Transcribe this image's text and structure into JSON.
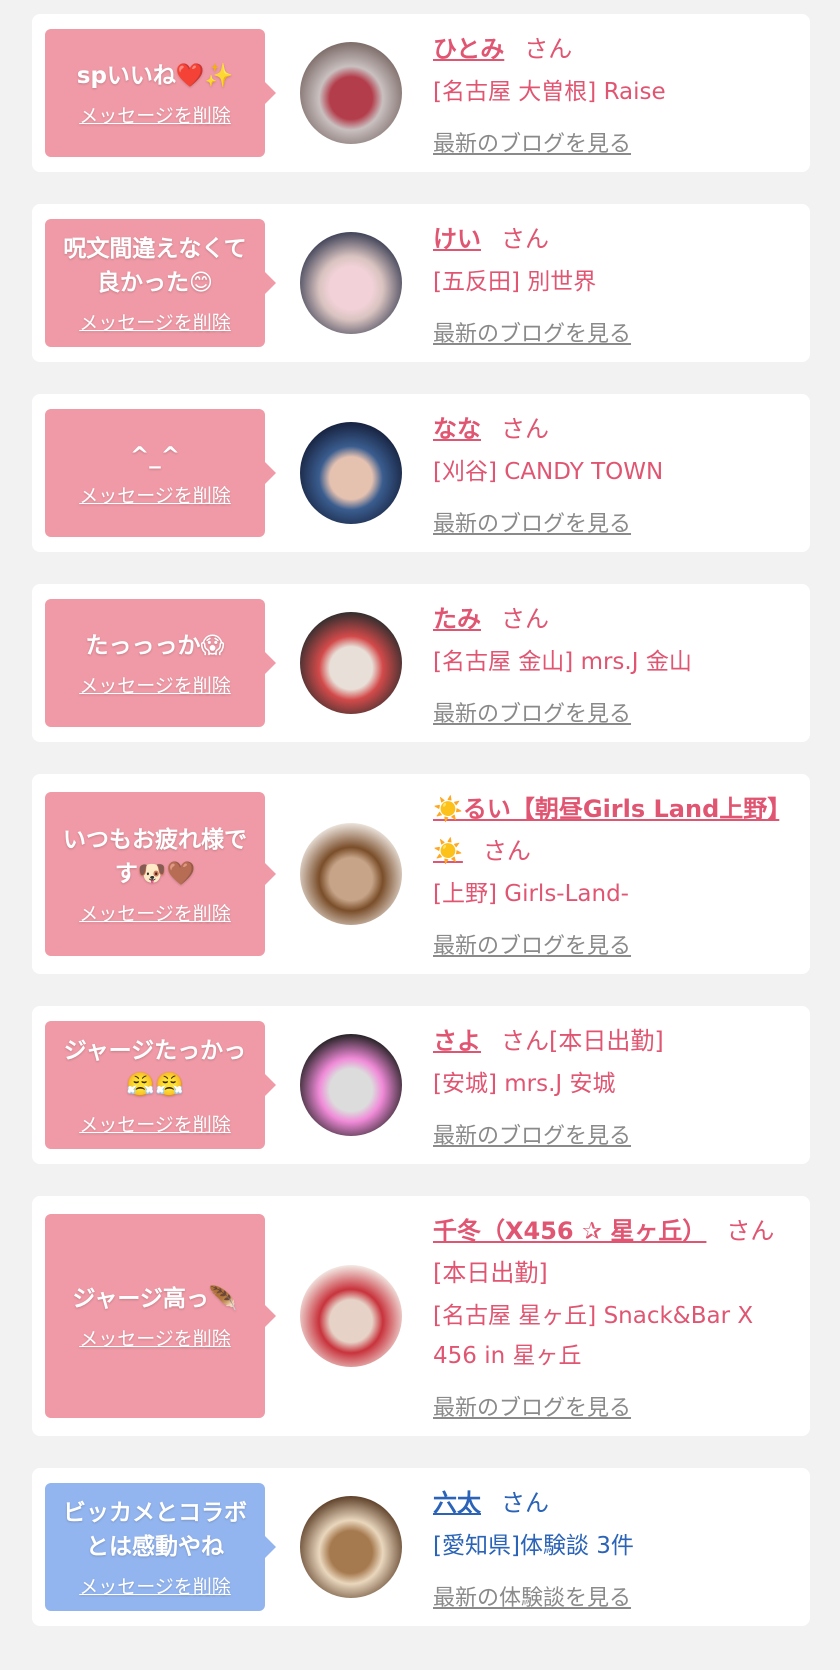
{
  "san_suffix": "さん",
  "delete_label": "メッセージを削除",
  "blog_label": "最新のブログを見る",
  "review_label": "最新の体験談を見る",
  "colors": {
    "pink_bubble": "#ef9aa6",
    "blue_bubble": "#93b5ef",
    "pink_text": "#e05672",
    "blue_text": "#2a63b7",
    "link_gray": "#8a8a8a"
  },
  "entries": [
    {
      "message": "spいいね❤️✨",
      "name": "ひとみ",
      "suffix_extra": "",
      "shop": "[名古屋 大曽根] Raise",
      "link": "最新のブログを見る",
      "variant": "pink"
    },
    {
      "message": "呪文間違えなくて良かった😊",
      "name": "けい",
      "suffix_extra": "",
      "shop": "[五反田] 別世界",
      "link": "最新のブログを見る",
      "variant": "pink"
    },
    {
      "message": "^_^",
      "name": "なな",
      "suffix_extra": "",
      "shop": "[刈谷] CANDY TOWN",
      "link": "最新のブログを見る",
      "variant": "pink"
    },
    {
      "message": "たっっっか😱",
      "name": "たみ",
      "suffix_extra": "",
      "shop": "[名古屋 金山] mrs.J 金山",
      "link": "最新のブログを見る",
      "variant": "pink"
    },
    {
      "message": "いつもお疲れ様です🐶🤎",
      "name": "☀️るい【朝昼Girls Land上野】☀️",
      "suffix_extra": "",
      "shop": "[上野] Girls-Land-",
      "link": "最新のブログを見る",
      "variant": "pink"
    },
    {
      "message": "ジャージたっかっ😤😤",
      "name": "さよ",
      "suffix_extra": "[本日出勤]",
      "shop": "[安城] mrs.J 安城",
      "link": "最新のブログを見る",
      "variant": "pink"
    },
    {
      "message": "ジャージ高っ🪶",
      "name": "千冬（X456 ✰ 星ヶ丘）",
      "suffix_extra": "[本日出勤]",
      "shop": "[名古屋 星ヶ丘] Snack&Bar X 456 in 星ヶ丘",
      "link": "最新のブログを見る",
      "variant": "pink"
    },
    {
      "message": "ビッカメとコラボとは感動やね",
      "name": "六太",
      "suffix_extra": "",
      "shop": "[愛知県]体験談 3件",
      "link": "最新の体験談を見る",
      "variant": "blue"
    }
  ]
}
